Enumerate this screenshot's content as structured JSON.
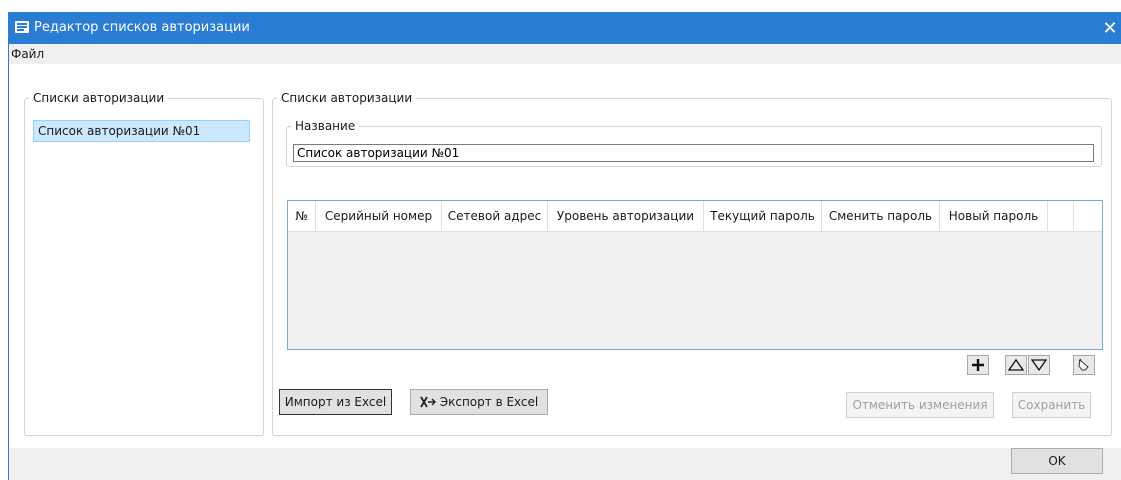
{
  "window": {
    "title": "Редактор списков авторизации",
    "accent_color": "#2b7cd3"
  },
  "menu": {
    "file": "Файл"
  },
  "left_panel": {
    "legend": "Списки авторизации",
    "items": [
      {
        "label": "Список авторизации №01",
        "selected": true
      }
    ]
  },
  "right_panel": {
    "legend": "Списки авторизации",
    "name_label": "Название",
    "name_value": "Список авторизации №01",
    "table": {
      "columns": [
        "№",
        "Серийный номер",
        "Сетевой адрес",
        "Уровень авторизации",
        "Текущий пароль",
        "Сменить пароль",
        "Новый пароль"
      ],
      "rows": []
    },
    "toolbar_icons": [
      "add-icon",
      "move-up-icon",
      "move-down-icon",
      "eraser-icon"
    ],
    "import_button": "Импорт из Excel",
    "export_button": "Экспорт в Excel",
    "cancel_button": "Отменить изменения",
    "save_button": "Сохранить"
  },
  "footer": {
    "ok_button": "OK"
  }
}
